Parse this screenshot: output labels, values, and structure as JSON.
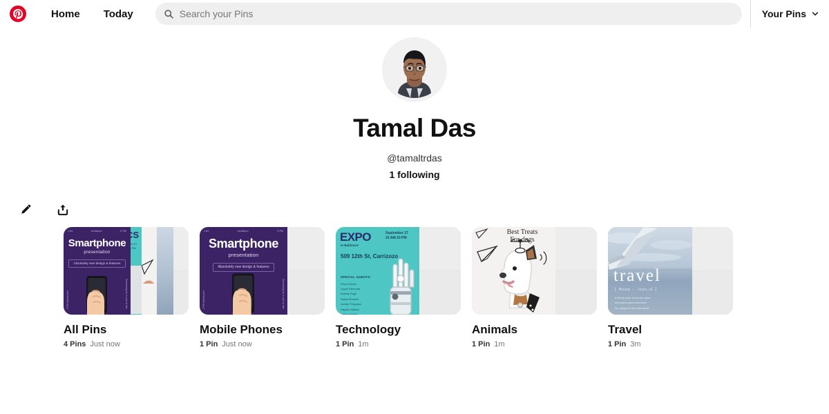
{
  "header": {
    "logo_icon": "pinterest-logo-icon",
    "logo_color": "#e60023",
    "nav": [
      {
        "label": "Home",
        "name": "nav-home"
      },
      {
        "label": "Today",
        "name": "nav-today"
      }
    ],
    "search": {
      "icon": "search-icon",
      "placeholder": "Search your Pins",
      "value": ""
    },
    "account": {
      "label": "Your Pins",
      "chevron_icon": "chevron-down-icon"
    }
  },
  "profile": {
    "avatar_icon": "avatar",
    "name": "Tamal Das",
    "handle": "@tamaltrdas",
    "following": "1 following"
  },
  "actions": [
    {
      "name": "edit-profile-button",
      "icon": "pencil-icon"
    },
    {
      "name": "share-profile-button",
      "icon": "share-upload-icon"
    }
  ],
  "boards": [
    {
      "title": "All Pins",
      "count": "4 Pins",
      "time": "Just now",
      "thumb_kind": "phone-multi"
    },
    {
      "title": "Mobile Phones",
      "count": "1 Pin",
      "time": "Just now",
      "thumb_kind": "phone"
    },
    {
      "title": "Technology",
      "count": "1 Pin",
      "time": "1m",
      "thumb_kind": "expo"
    },
    {
      "title": "Animals",
      "count": "1 Pin",
      "time": "1m",
      "thumb_kind": "dog"
    },
    {
      "title": "Travel",
      "count": "1 Pin",
      "time": "3m",
      "thumb_kind": "travel"
    }
  ],
  "art": {
    "phone": {
      "top_left": "1.84",
      "top_mid": "invitation",
      "top_right": "9 PM",
      "title": "Smartphone",
      "subtitle": "presentation",
      "tagline": "Absolutely new design & features",
      "vleft": "2750 Alberta Ave",
      "vright": "Somebody for a cool of site"
    },
    "expo": {
      "title": "EXPO",
      "city": "In Baltimore",
      "date": "September 27",
      "hours": "10 AM-10 PM",
      "address": "509 12th St, Carrizozo",
      "guests_header": "SPECIAL GUESTS:",
      "guests": "Erica Fischer\nLayne Stennard\nAudrey Page\nSasha Russell\nJordan Ferguson\nHayden Wilson\nAdrian Hartley"
    },
    "dog": {
      "title": "Best Treats\nFor dogs"
    },
    "travel": {
      "word": "travel",
      "phonetic": "[ Noun - ˈtrav.əl ]",
      "body": "In the far wide, across the space\nand start to pack a few times\nthe voyage for the entire words"
    }
  }
}
